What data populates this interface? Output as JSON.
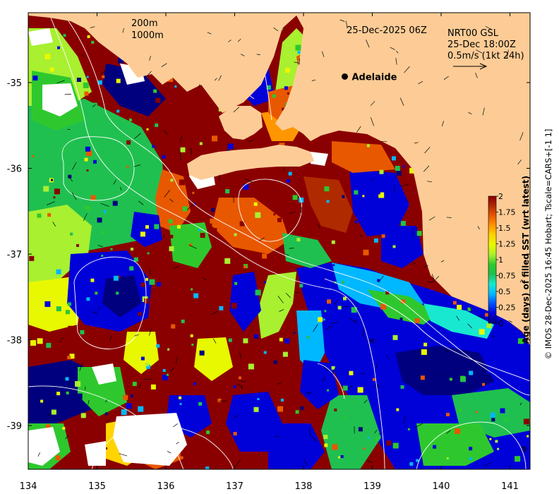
{
  "map": {
    "timestamp": "25-Dec-2025 06Z",
    "product": {
      "line1": "NRT00 GSL",
      "line2": "25-Dec 18:00Z",
      "line3": "0.5m/s (1kt 24h)"
    },
    "isobath_legend": {
      "shallow": "200m",
      "deep": "1000m"
    },
    "place": {
      "name": "Adelaide",
      "lon": 138.6,
      "lat": -34.93
    },
    "credit": "© IMOS 28-Dec-2025 16:45 Hobart; Tscale=CARS+[-1 1]",
    "x_axis": {
      "ticks": [
        134,
        135,
        136,
        137,
        138,
        139,
        140,
        141
      ],
      "tick_labels": [
        "134",
        "135",
        "136",
        "137",
        "138",
        "139",
        "140",
        "141"
      ],
      "range": [
        134,
        141.3
      ]
    },
    "y_axis": {
      "ticks": [
        -35,
        -36,
        -37,
        -38,
        -39
      ],
      "tick_labels": [
        "-35",
        "-36",
        "-37",
        "-38",
        "-39"
      ],
      "range": [
        -39.5,
        -34.2
      ]
    },
    "colorbar": {
      "label": "Age (days) of filled SST (wrt latest)",
      "ticks": [
        0,
        0.25,
        0.5,
        0.75,
        1,
        1.25,
        1.5,
        1.75,
        2
      ],
      "tick_labels": [
        "0",
        "0.25",
        "0.5",
        "0.75",
        "1",
        "1.25",
        "1.5",
        "1.75",
        "2"
      ],
      "range": [
        0,
        2
      ],
      "colors": [
        "#00007f",
        "#0000d8",
        "#0050ff",
        "#00b8ff",
        "#18e8d0",
        "#20c050",
        "#2ec82e",
        "#a8f030",
        "#e8f800",
        "#ffd400",
        "#ff9600",
        "#e85800",
        "#b02a00",
        "#8a0000"
      ]
    },
    "colors": {
      "land": "#fdcc96",
      "water_gap": "#ffffff",
      "contour": "#ffffff"
    }
  }
}
